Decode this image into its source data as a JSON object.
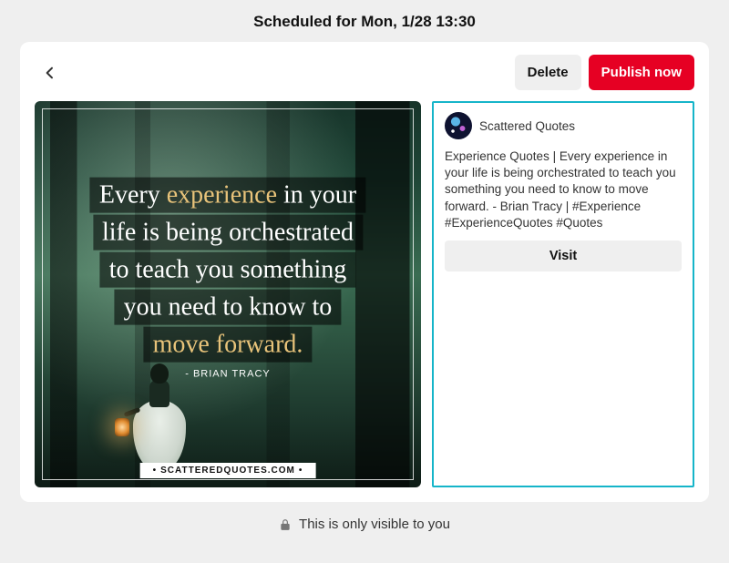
{
  "header": {
    "title": "Scheduled for Mon, 1/28 13:30"
  },
  "actions": {
    "delete_label": "Delete",
    "publish_label": "Publish now"
  },
  "pin_image": {
    "quote_line1_a": "Every ",
    "quote_line1_hl": "experience",
    "quote_line1_b": " in your",
    "quote_line2": "life is being orchestrated",
    "quote_line3": "to teach you something",
    "quote_line4": "you need to know to",
    "quote_line5_hl": "move forward.",
    "attribution": "- BRIAN TRACY",
    "watermark": "SCATTEREDQUOTES.COM"
  },
  "info": {
    "profile_name": "Scattered Quotes",
    "description": "Experience Quotes | Every experience in your life is being orchestrated to teach you something you need to know to move forward. - Brian Tracy | #Experience #ExperienceQuotes #Quotes",
    "visit_label": "Visit"
  },
  "footer": {
    "visibility_text": "This is only visible to you"
  },
  "colors": {
    "primary": "#e60023",
    "panel_border": "#16b5c9"
  }
}
